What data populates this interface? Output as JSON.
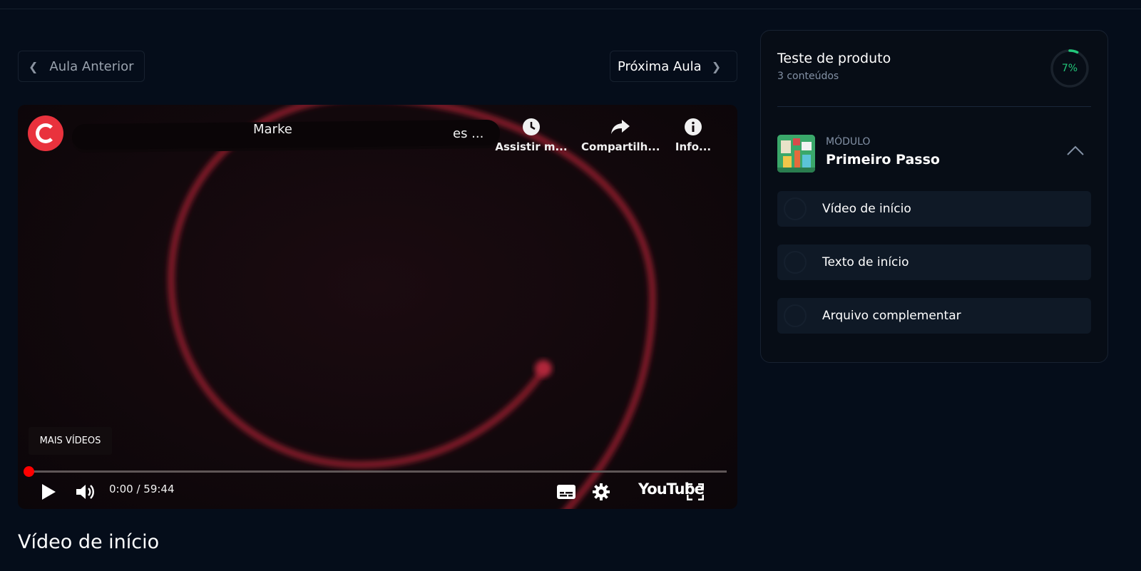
{
  "navigation": {
    "prev_label": "Aula Anterior",
    "next_label": "Próxima Aula"
  },
  "video": {
    "title_visible_fragment_a": "Marke",
    "title_visible_fragment_b": "es ...",
    "actions": [
      {
        "label": "Assistir m...",
        "icon": "clock-icon"
      },
      {
        "label": "Compartilh...",
        "icon": "share-icon"
      },
      {
        "label": "Info...",
        "icon": "info-icon"
      }
    ],
    "more_videos_label": "MAIS VÍDEOS",
    "time_display": "0:00 / 59:44",
    "progress_fraction": 0.0,
    "brand_word": "YouTube",
    "colors": {
      "accent": "#ff0000",
      "logo": "#e9323d"
    }
  },
  "lesson": {
    "title": "Vídeo de início"
  },
  "course_panel": {
    "title": "Teste de produto",
    "subtitle": "3 conteúdos",
    "progress_percent_label": "7%",
    "progress_fraction": 0.07,
    "progress_color": "#22c77a",
    "module": {
      "label": "MÓDULO",
      "name": "Primeiro Passo",
      "expanded": true,
      "items": [
        {
          "label": "Vídeo de início",
          "completed": false
        },
        {
          "label": "Texto de início",
          "completed": false
        },
        {
          "label": "Arquivo complementar",
          "completed": false
        }
      ]
    }
  }
}
